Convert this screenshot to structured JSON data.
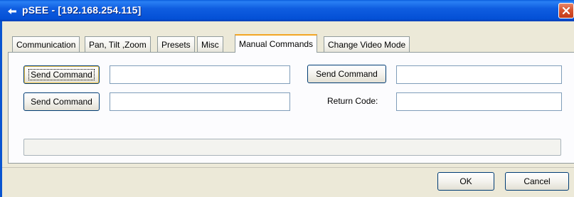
{
  "window": {
    "title": "pSEE - [192.168.254.115]",
    "title_bar_color": "#0a5ddc",
    "close_color": "#d9542e"
  },
  "tabs": [
    {
      "label": "Communication",
      "active": false
    },
    {
      "label": "Pan, Tilt ,Zoom",
      "active": false
    },
    {
      "label": "Presets",
      "active": false
    },
    {
      "label": "Misc",
      "active": false
    },
    {
      "label": "Manual Commands",
      "active": true
    },
    {
      "label": "Change Video Mode",
      "active": false
    }
  ],
  "manual_commands": {
    "send_command_1": "Send Command",
    "command_input_1": "",
    "send_command_2": "Send Command",
    "command_input_2": "",
    "send_command_3": "Send Command",
    "command_input_3": "",
    "return_code_label": "Return Code:",
    "return_code_value": ""
  },
  "progress": {
    "value": 0
  },
  "footer": {
    "ok_label": "OK",
    "cancel_label": "Cancel"
  }
}
